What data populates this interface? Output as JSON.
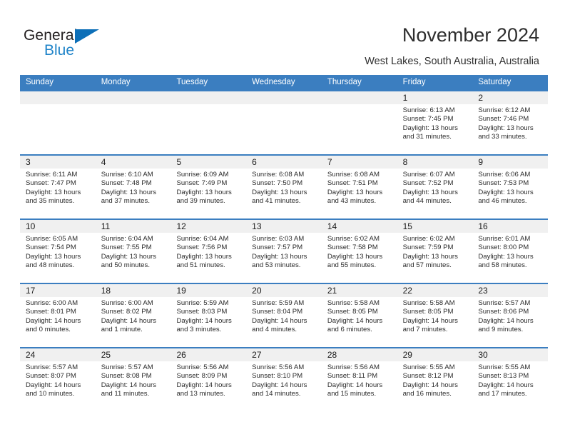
{
  "brand": {
    "name_part1": "General",
    "name_part2": "Blue",
    "triangle_color": "#0d6fb8",
    "blue_text_color": "#1e83c8"
  },
  "header": {
    "title": "November 2024",
    "subtitle": "West Lakes, South Australia, Australia",
    "accent_color": "#3b7ec0"
  },
  "weekdays": [
    "Sunday",
    "Monday",
    "Tuesday",
    "Wednesday",
    "Thursday",
    "Friday",
    "Saturday"
  ],
  "weeks": [
    {
      "days": [
        {
          "num": "",
          "sunrise": "",
          "sunset": "",
          "daylight1": "",
          "daylight2": ""
        },
        {
          "num": "",
          "sunrise": "",
          "sunset": "",
          "daylight1": "",
          "daylight2": ""
        },
        {
          "num": "",
          "sunrise": "",
          "sunset": "",
          "daylight1": "",
          "daylight2": ""
        },
        {
          "num": "",
          "sunrise": "",
          "sunset": "",
          "daylight1": "",
          "daylight2": ""
        },
        {
          "num": "",
          "sunrise": "",
          "sunset": "",
          "daylight1": "",
          "daylight2": ""
        },
        {
          "num": "1",
          "sunrise": "Sunrise: 6:13 AM",
          "sunset": "Sunset: 7:45 PM",
          "daylight1": "Daylight: 13 hours",
          "daylight2": "and 31 minutes."
        },
        {
          "num": "2",
          "sunrise": "Sunrise: 6:12 AM",
          "sunset": "Sunset: 7:46 PM",
          "daylight1": "Daylight: 13 hours",
          "daylight2": "and 33 minutes."
        }
      ]
    },
    {
      "days": [
        {
          "num": "3",
          "sunrise": "Sunrise: 6:11 AM",
          "sunset": "Sunset: 7:47 PM",
          "daylight1": "Daylight: 13 hours",
          "daylight2": "and 35 minutes."
        },
        {
          "num": "4",
          "sunrise": "Sunrise: 6:10 AM",
          "sunset": "Sunset: 7:48 PM",
          "daylight1": "Daylight: 13 hours",
          "daylight2": "and 37 minutes."
        },
        {
          "num": "5",
          "sunrise": "Sunrise: 6:09 AM",
          "sunset": "Sunset: 7:49 PM",
          "daylight1": "Daylight: 13 hours",
          "daylight2": "and 39 minutes."
        },
        {
          "num": "6",
          "sunrise": "Sunrise: 6:08 AM",
          "sunset": "Sunset: 7:50 PM",
          "daylight1": "Daylight: 13 hours",
          "daylight2": "and 41 minutes."
        },
        {
          "num": "7",
          "sunrise": "Sunrise: 6:08 AM",
          "sunset": "Sunset: 7:51 PM",
          "daylight1": "Daylight: 13 hours",
          "daylight2": "and 43 minutes."
        },
        {
          "num": "8",
          "sunrise": "Sunrise: 6:07 AM",
          "sunset": "Sunset: 7:52 PM",
          "daylight1": "Daylight: 13 hours",
          "daylight2": "and 44 minutes."
        },
        {
          "num": "9",
          "sunrise": "Sunrise: 6:06 AM",
          "sunset": "Sunset: 7:53 PM",
          "daylight1": "Daylight: 13 hours",
          "daylight2": "and 46 minutes."
        }
      ]
    },
    {
      "days": [
        {
          "num": "10",
          "sunrise": "Sunrise: 6:05 AM",
          "sunset": "Sunset: 7:54 PM",
          "daylight1": "Daylight: 13 hours",
          "daylight2": "and 48 minutes."
        },
        {
          "num": "11",
          "sunrise": "Sunrise: 6:04 AM",
          "sunset": "Sunset: 7:55 PM",
          "daylight1": "Daylight: 13 hours",
          "daylight2": "and 50 minutes."
        },
        {
          "num": "12",
          "sunrise": "Sunrise: 6:04 AM",
          "sunset": "Sunset: 7:56 PM",
          "daylight1": "Daylight: 13 hours",
          "daylight2": "and 51 minutes."
        },
        {
          "num": "13",
          "sunrise": "Sunrise: 6:03 AM",
          "sunset": "Sunset: 7:57 PM",
          "daylight1": "Daylight: 13 hours",
          "daylight2": "and 53 minutes."
        },
        {
          "num": "14",
          "sunrise": "Sunrise: 6:02 AM",
          "sunset": "Sunset: 7:58 PM",
          "daylight1": "Daylight: 13 hours",
          "daylight2": "and 55 minutes."
        },
        {
          "num": "15",
          "sunrise": "Sunrise: 6:02 AM",
          "sunset": "Sunset: 7:59 PM",
          "daylight1": "Daylight: 13 hours",
          "daylight2": "and 57 minutes."
        },
        {
          "num": "16",
          "sunrise": "Sunrise: 6:01 AM",
          "sunset": "Sunset: 8:00 PM",
          "daylight1": "Daylight: 13 hours",
          "daylight2": "and 58 minutes."
        }
      ]
    },
    {
      "days": [
        {
          "num": "17",
          "sunrise": "Sunrise: 6:00 AM",
          "sunset": "Sunset: 8:01 PM",
          "daylight1": "Daylight: 14 hours",
          "daylight2": "and 0 minutes."
        },
        {
          "num": "18",
          "sunrise": "Sunrise: 6:00 AM",
          "sunset": "Sunset: 8:02 PM",
          "daylight1": "Daylight: 14 hours",
          "daylight2": "and 1 minute."
        },
        {
          "num": "19",
          "sunrise": "Sunrise: 5:59 AM",
          "sunset": "Sunset: 8:03 PM",
          "daylight1": "Daylight: 14 hours",
          "daylight2": "and 3 minutes."
        },
        {
          "num": "20",
          "sunrise": "Sunrise: 5:59 AM",
          "sunset": "Sunset: 8:04 PM",
          "daylight1": "Daylight: 14 hours",
          "daylight2": "and 4 minutes."
        },
        {
          "num": "21",
          "sunrise": "Sunrise: 5:58 AM",
          "sunset": "Sunset: 8:05 PM",
          "daylight1": "Daylight: 14 hours",
          "daylight2": "and 6 minutes."
        },
        {
          "num": "22",
          "sunrise": "Sunrise: 5:58 AM",
          "sunset": "Sunset: 8:05 PM",
          "daylight1": "Daylight: 14 hours",
          "daylight2": "and 7 minutes."
        },
        {
          "num": "23",
          "sunrise": "Sunrise: 5:57 AM",
          "sunset": "Sunset: 8:06 PM",
          "daylight1": "Daylight: 14 hours",
          "daylight2": "and 9 minutes."
        }
      ]
    },
    {
      "days": [
        {
          "num": "24",
          "sunrise": "Sunrise: 5:57 AM",
          "sunset": "Sunset: 8:07 PM",
          "daylight1": "Daylight: 14 hours",
          "daylight2": "and 10 minutes."
        },
        {
          "num": "25",
          "sunrise": "Sunrise: 5:57 AM",
          "sunset": "Sunset: 8:08 PM",
          "daylight1": "Daylight: 14 hours",
          "daylight2": "and 11 minutes."
        },
        {
          "num": "26",
          "sunrise": "Sunrise: 5:56 AM",
          "sunset": "Sunset: 8:09 PM",
          "daylight1": "Daylight: 14 hours",
          "daylight2": "and 13 minutes."
        },
        {
          "num": "27",
          "sunrise": "Sunrise: 5:56 AM",
          "sunset": "Sunset: 8:10 PM",
          "daylight1": "Daylight: 14 hours",
          "daylight2": "and 14 minutes."
        },
        {
          "num": "28",
          "sunrise": "Sunrise: 5:56 AM",
          "sunset": "Sunset: 8:11 PM",
          "daylight1": "Daylight: 14 hours",
          "daylight2": "and 15 minutes."
        },
        {
          "num": "29",
          "sunrise": "Sunrise: 5:55 AM",
          "sunset": "Sunset: 8:12 PM",
          "daylight1": "Daylight: 14 hours",
          "daylight2": "and 16 minutes."
        },
        {
          "num": "30",
          "sunrise": "Sunrise: 5:55 AM",
          "sunset": "Sunset: 8:13 PM",
          "daylight1": "Daylight: 14 hours",
          "daylight2": "and 17 minutes."
        }
      ]
    }
  ]
}
